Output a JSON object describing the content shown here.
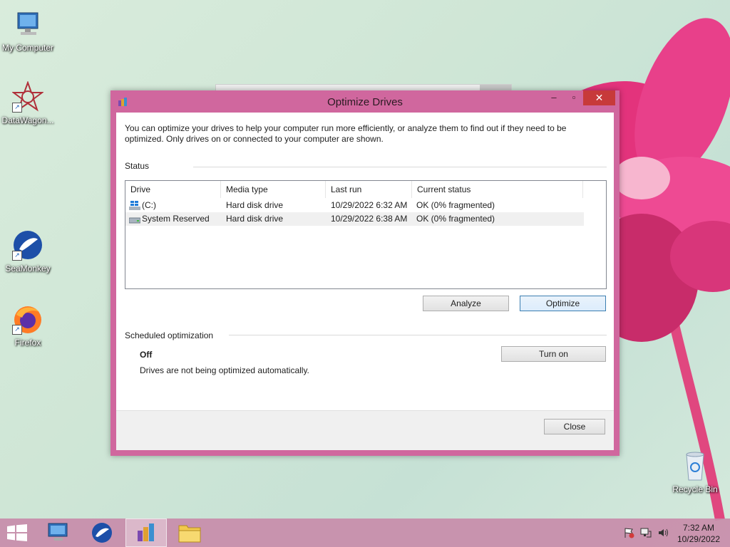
{
  "desktop": {
    "icons": [
      {
        "label": "My Computer"
      },
      {
        "label": "DataWagon..."
      },
      {
        "label": "SeaMonkey"
      },
      {
        "label": "Firefox"
      },
      {
        "label": "Recycle Bin"
      }
    ]
  },
  "dialog": {
    "title": "Optimize Drives",
    "intro": "You can optimize your drives to help your computer run more efficiently, or analyze them to find out if they need to be optimized. Only drives on or connected to your computer are shown.",
    "status_heading": "Status",
    "columns": [
      "Drive",
      "Media type",
      "Last run",
      "Current status"
    ],
    "drives": [
      {
        "drive": "(C:)",
        "media": "Hard disk drive",
        "last_run": "10/29/2022 6:32 AM",
        "status": "OK (0% fragmented)",
        "icon": "windows-drive-icon"
      },
      {
        "drive": "System Reserved",
        "media": "Hard disk drive",
        "last_run": "10/29/2022 6:38 AM",
        "status": "OK (0% fragmented)",
        "icon": "hard-drive-icon"
      }
    ],
    "analyze_label": "Analyze",
    "optimize_label": "Optimize",
    "scheduled_heading": "Scheduled optimization",
    "schedule_state": "Off",
    "schedule_desc": "Drives are not being optimized automatically.",
    "turn_on_label": "Turn on",
    "close_label": "Close"
  },
  "taskbar": {
    "time": "7:32 AM",
    "date": "10/29/2022"
  },
  "colors": {
    "dialog_frame": "#d0679e",
    "close_button": "#c73a3a",
    "taskbar": "#c88caa"
  }
}
